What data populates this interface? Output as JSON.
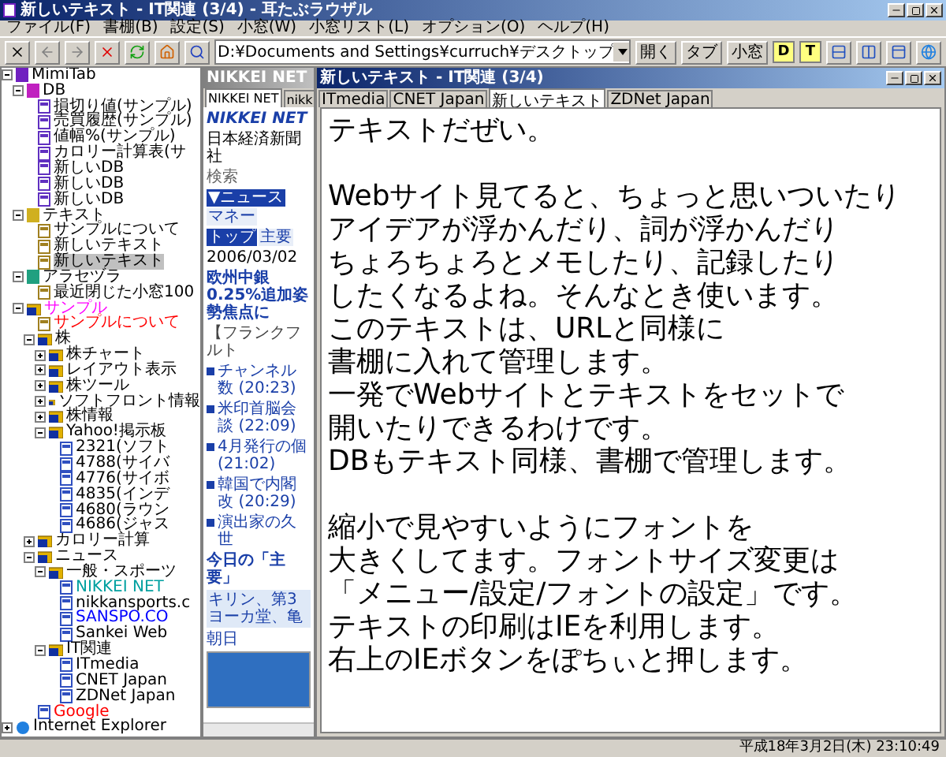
{
  "window": {
    "title": "新しいテキスト - IT関連 (3/4) - 耳たぶラウザル"
  },
  "menu": [
    "ファイル(F)",
    "書棚(B)",
    "設定(S)",
    "小窓(W)",
    "小窓リスト(L)",
    "オプション(O)",
    "ヘルプ(H)"
  ],
  "toolbar": {
    "address": "D:¥Documents and Settings¥curruch¥デスクトップ",
    "buttons": [
      "開く",
      "タブ",
      "小窓"
    ],
    "toggles": [
      {
        "label": "D",
        "on": true
      },
      {
        "label": "T",
        "on": true
      }
    ]
  },
  "tree": [
    {
      "label": "MimiTab",
      "kind": "root",
      "color": "#000000",
      "selected": false,
      "expanded": true,
      "children": [
        {
          "label": "DB",
          "kind": "db",
          "color": "#000000",
          "selected": false,
          "expanded": true,
          "children": [
            {
              "label": "損切り値(サンプル)",
              "kind": "dbpage",
              "color": "#000000",
              "selected": false
            },
            {
              "label": "売買履歴(サンプル)",
              "kind": "dbpage",
              "color": "#000000",
              "selected": false
            },
            {
              "label": "値幅%(サンプル)",
              "kind": "dbpage",
              "color": "#000000",
              "selected": false
            },
            {
              "label": "カロリー計算表(サ",
              "kind": "dbpage",
              "color": "#000000",
              "selected": false
            },
            {
              "label": "新しいDB",
              "kind": "dbpage",
              "color": "#000000",
              "selected": false
            },
            {
              "label": "新しいDB",
              "kind": "dbpage",
              "color": "#000000",
              "selected": false
            },
            {
              "label": "新しいDB",
              "kind": "dbpage",
              "color": "#000000",
              "selected": false
            }
          ]
        },
        {
          "label": "テキスト",
          "kind": "text",
          "color": "#000000",
          "selected": false,
          "expanded": true,
          "children": [
            {
              "label": "サンプルについて",
              "kind": "textpage",
              "color": "#000000",
              "selected": false
            },
            {
              "label": "新しいテキスト",
              "kind": "textpage",
              "color": "#000000",
              "selected": false
            },
            {
              "label": "新しいテキスト",
              "kind": "textpage",
              "color": "#000000",
              "selected": true
            }
          ]
        },
        {
          "label": "アラセヅラ",
          "kind": "tool",
          "color": "#000000",
          "selected": false,
          "expanded": true,
          "children": [
            {
              "label": "最近閉じた小窓100",
              "kind": "textpage",
              "color": "#000000",
              "selected": false
            }
          ]
        },
        {
          "label": "サンプル",
          "kind": "folder",
          "color": "#ff00ff",
          "selected": false,
          "expanded": true,
          "children": [
            {
              "label": "サンプルについて",
              "kind": "textpage",
              "color": "#ff0000",
              "selected": false
            },
            {
              "label": "株",
              "kind": "folder",
              "color": "#000000",
              "selected": false,
              "expanded": true,
              "children": [
                {
                  "label": "株チャート",
                  "kind": "folder",
                  "color": "#000000",
                  "selected": false,
                  "expanded": false
                },
                {
                  "label": "レイアウト表示",
                  "kind": "folder",
                  "color": "#000000",
                  "selected": false,
                  "expanded": false
                },
                {
                  "label": "株ツール",
                  "kind": "folder",
                  "color": "#000000",
                  "selected": false,
                  "expanded": false
                },
                {
                  "label": "ソフトフロント情報",
                  "kind": "folder",
                  "color": "#000000",
                  "selected": false,
                  "expanded": false
                },
                {
                  "label": "株情報",
                  "kind": "folder",
                  "color": "#000000",
                  "selected": false,
                  "expanded": false
                },
                {
                  "label": "Yahoo!掲示板",
                  "kind": "folder",
                  "color": "#000000",
                  "selected": false,
                  "expanded": true,
                  "children": [
                    {
                      "label": "2321(ソフト",
                      "kind": "page",
                      "color": "#000000",
                      "selected": false
                    },
                    {
                      "label": "4788(サイバ",
                      "kind": "page",
                      "color": "#000000",
                      "selected": false
                    },
                    {
                      "label": "4776(サイボ",
                      "kind": "page",
                      "color": "#000000",
                      "selected": false
                    },
                    {
                      "label": "4835(インデ",
                      "kind": "page",
                      "color": "#000000",
                      "selected": false
                    },
                    {
                      "label": "4680(ラウン",
                      "kind": "page",
                      "color": "#000000",
                      "selected": false
                    },
                    {
                      "label": "4686(ジャス",
                      "kind": "page",
                      "color": "#000000",
                      "selected": false
                    }
                  ]
                }
              ]
            },
            {
              "label": "カロリー計算",
              "kind": "folder",
              "color": "#000000",
              "selected": false,
              "expanded": false
            },
            {
              "label": "ニュース",
              "kind": "folder",
              "color": "#000000",
              "selected": false,
              "expanded": true,
              "children": [
                {
                  "label": "一般・スポーツ",
                  "kind": "folder",
                  "color": "#000000",
                  "selected": false,
                  "expanded": true,
                  "children": [
                    {
                      "label": "NIKKEI NET",
                      "kind": "page",
                      "color": "#00a0a0",
                      "selected": false
                    },
                    {
                      "label": "nikkansports.c",
                      "kind": "page",
                      "color": "#000000",
                      "selected": false
                    },
                    {
                      "label": "SANSPO.CO",
                      "kind": "page",
                      "color": "#0000ff",
                      "selected": false
                    },
                    {
                      "label": "Sankei Web",
                      "kind": "page",
                      "color": "#000000",
                      "selected": false
                    }
                  ]
                },
                {
                  "label": "IT関連",
                  "kind": "folder",
                  "color": "#000000",
                  "selected": false,
                  "expanded": true,
                  "children": [
                    {
                      "label": "ITmedia",
                      "kind": "page",
                      "color": "#000000",
                      "selected": false
                    },
                    {
                      "label": "CNET Japan",
                      "kind": "page",
                      "color": "#000000",
                      "selected": false
                    },
                    {
                      "label": "ZDNet Japan",
                      "kind": "page",
                      "color": "#000000",
                      "selected": false
                    }
                  ]
                }
              ]
            },
            {
              "label": "Google",
              "kind": "page",
              "color": "#ff0000",
              "selected": false
            }
          ]
        }
      ]
    },
    {
      "label": "Internet Explorer",
      "kind": "ie",
      "color": "#000000",
      "selected": false,
      "expanded": false
    }
  ],
  "web_window": {
    "title": "NIKKEI NET",
    "tabs": [
      {
        "label": "NIKKEI NET",
        "selected": true
      },
      {
        "label": "nikk",
        "selected": false
      }
    ],
    "page": {
      "logo": "NIKKEI NET",
      "logo_sub": "日本経済新聞社",
      "search": "検索",
      "nav": [
        {
          "label": "▼ニュース",
          "selected": true
        },
        {
          "label": "マネー",
          "selected": false
        }
      ],
      "subnav": [
        {
          "label": "トップ",
          "selected": true
        },
        {
          "label": "主要",
          "selected": false
        }
      ],
      "updated": "2006/03/02",
      "headline": "欧州中銀0.25%追加姿勢焦点に",
      "lead": "【フランクフルト",
      "news": [
        {
          "text": "チャンネル数",
          "time": "(20:23)"
        },
        {
          "text": "米印首脳会談",
          "time": "(22:09)"
        },
        {
          "text": "4月発行の個",
          "time": "(21:02)"
        },
        {
          "text": "韓国で内閣改",
          "time": "(20:29)"
        },
        {
          "text": "演出家の久世"
        }
      ],
      "more_link": "今日の「主要」",
      "promo": [
        "キリン、第3",
        "ヨーカ堂、亀"
      ],
      "side_link": "朝日"
    }
  },
  "text_window": {
    "title": "新しいテキスト - IT関連 (3/4)",
    "tabs": [
      {
        "label": "ITmedia",
        "selected": false
      },
      {
        "label": "CNET Japan",
        "selected": false
      },
      {
        "label": "新しいテキスト",
        "selected": true
      },
      {
        "label": "ZDNet Japan",
        "selected": false
      }
    ],
    "paragraphs": [
      [
        "テキストだぜい。"
      ],
      [
        "Webサイト見てると、ちょっと思いついたり",
        "アイデアが浮かんだり、詞が浮かんだり",
        "ちょろちょろとメモしたり、記録したり",
        "したくなるよね。そんなとき使います。",
        "このテキストは、URLと同様に",
        "書棚に入れて管理します。",
        "一発でWebサイトとテキストをセットで",
        "開いたりできるわけです。",
        "DBもテキスト同様、書棚で管理します。"
      ],
      [
        "縮小で見やすいようにフォントを",
        "大きくしてます。フォントサイズ変更は",
        "「メニュー/設定/フォントの設定」です。",
        "テキストの印刷はIEを利用します。",
        "右上のIEボタンをぽちぃと押します。"
      ]
    ]
  },
  "status_bar": "平成18年3月2日(木) 23:10:49"
}
